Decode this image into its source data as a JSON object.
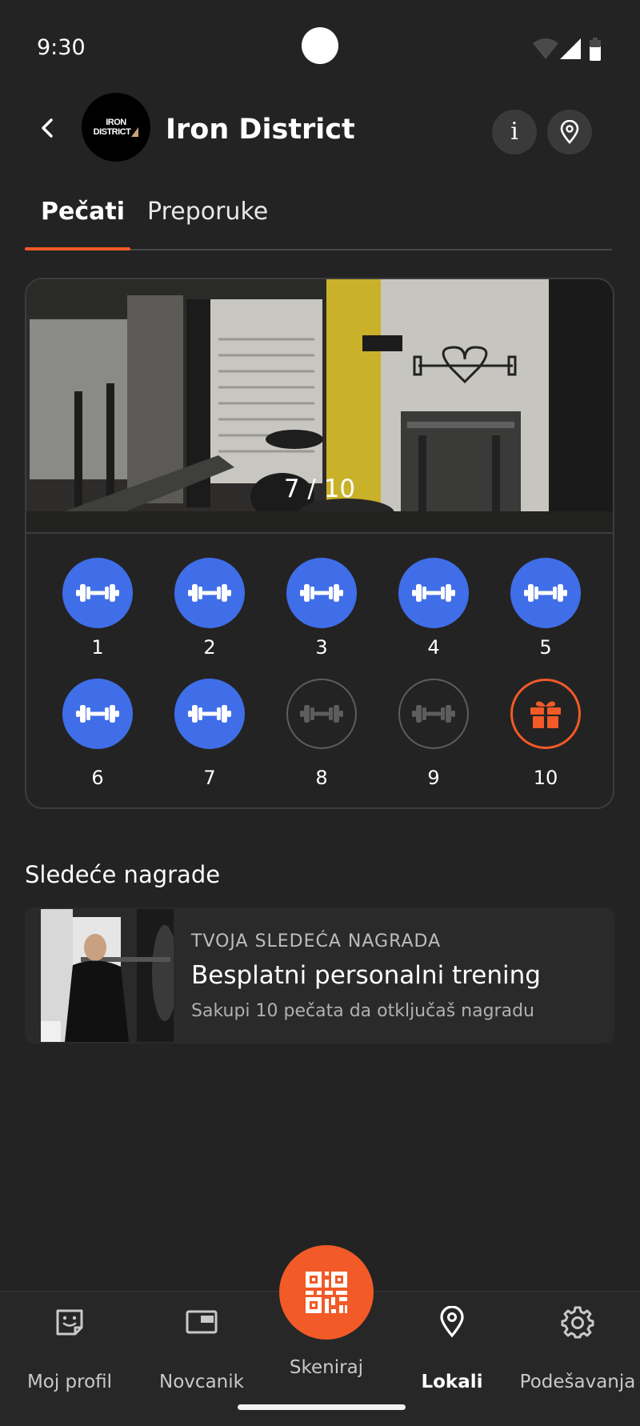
{
  "status_bar": {
    "time": "9:30"
  },
  "header": {
    "title": "Iron District",
    "logo_line1": "IRON",
    "logo_line2": "DISTRICT",
    "back_icon": "arrow-back-icon",
    "info_icon": "info-icon",
    "location_icon": "location-pin-icon"
  },
  "tabs": [
    {
      "label": "Pečati",
      "active": true
    },
    {
      "label": "Preporuke",
      "active": false
    }
  ],
  "stamp_card": {
    "progress_text": "7 / 10",
    "collected": 7,
    "total": 10,
    "stamps": [
      {
        "number": "1",
        "state": "filled",
        "icon": "dumbbell-icon"
      },
      {
        "number": "2",
        "state": "filled",
        "icon": "dumbbell-icon"
      },
      {
        "number": "3",
        "state": "filled",
        "icon": "dumbbell-icon"
      },
      {
        "number": "4",
        "state": "filled",
        "icon": "dumbbell-icon"
      },
      {
        "number": "5",
        "state": "filled",
        "icon": "dumbbell-icon"
      },
      {
        "number": "6",
        "state": "filled",
        "icon": "dumbbell-icon"
      },
      {
        "number": "7",
        "state": "filled",
        "icon": "dumbbell-icon"
      },
      {
        "number": "8",
        "state": "empty",
        "icon": "dumbbell-icon"
      },
      {
        "number": "9",
        "state": "empty",
        "icon": "dumbbell-icon"
      },
      {
        "number": "10",
        "state": "reward",
        "icon": "gift-icon"
      }
    ]
  },
  "next_rewards": {
    "title": "Sledeće nagrade",
    "caption": "TVOJA SLEDEĆA NAGRADA",
    "name": "Besplatni personalni trening",
    "hint": "Sakupi 10 pečata da otključaš nagradu"
  },
  "bottom_nav": {
    "items": [
      {
        "label": "Moj profil",
        "icon": "profile-card-icon",
        "active": false
      },
      {
        "label": "Novcanik",
        "icon": "wallet-icon",
        "active": false
      },
      {
        "label": "Skeniraj",
        "icon": "qr-code-icon",
        "active": false
      },
      {
        "label": "Lokali",
        "icon": "location-pin-icon",
        "active": true
      },
      {
        "label": "Podešavanja",
        "icon": "gear-icon",
        "active": false
      }
    ]
  },
  "colors": {
    "background": "#232323",
    "accent": "#f25a27",
    "stamp_filled": "#3f6ee8",
    "stamp_empty_border": "#5d5d5d"
  }
}
